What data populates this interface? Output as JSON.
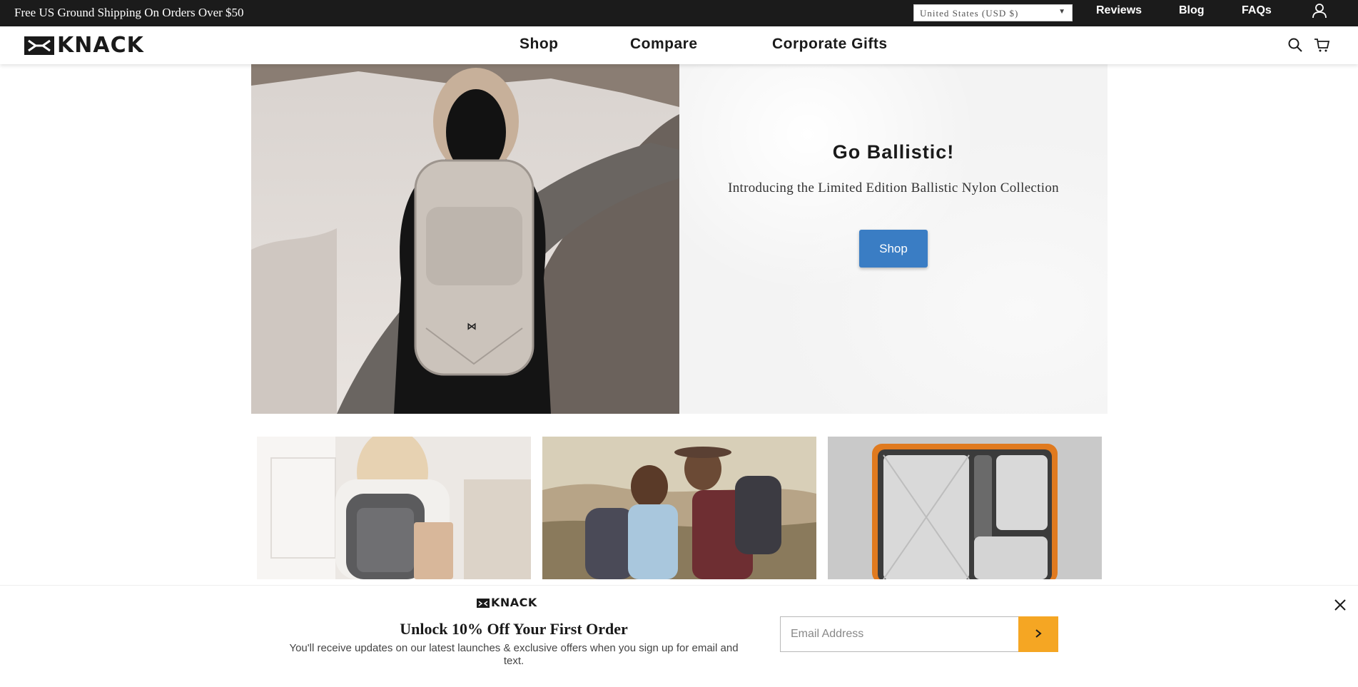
{
  "topbar": {
    "promo": "Free US Ground Shipping On Orders Over $50",
    "country_select": "United States (USD $)",
    "links": [
      "Reviews",
      "Blog",
      "FAQs"
    ],
    "account_icon": "user-icon"
  },
  "header": {
    "logo_text": "KNACK",
    "nav": [
      "Shop",
      "Compare",
      "Corporate Gifts"
    ],
    "icons": [
      "search-icon",
      "cart-icon"
    ]
  },
  "hero": {
    "title": "Go Ballistic!",
    "subtitle": "Introducing the Limited Edition Ballistic Nylon Collection",
    "button_label": "Shop"
  },
  "signup": {
    "logo_text": "KNACK",
    "title": "Unlock 10% Off Your First Order",
    "description": "You'll receive updates on our latest launches & exclusive offers when you sign up for email and text.",
    "email_placeholder": "Email Address",
    "submit_icon": "chevron-right-icon",
    "close_icon": "close-icon"
  },
  "colors": {
    "topbar_bg": "#1b1b1b",
    "accent_blue": "#3a7dc4",
    "submit_orange": "#f5a623"
  }
}
